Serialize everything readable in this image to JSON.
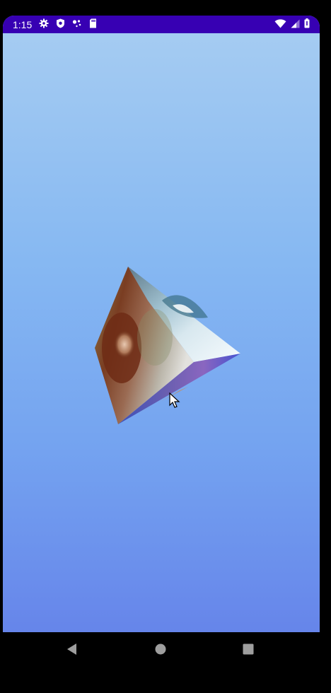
{
  "status_bar": {
    "time": "1:15",
    "background": "#3700b3",
    "left_icons": [
      "settings-icon",
      "shield-icon",
      "assistant-dots-icon",
      "sd-card-icon"
    ],
    "right_icons": [
      "wifi-icon",
      "cell-signal-icon",
      "battery-icon"
    ]
  },
  "screen": {
    "gradient_top": "#a7cdf2",
    "gradient_bottom": "#6685ea",
    "content": "rotating-image-cube"
  },
  "cube": {
    "faces": [
      "portrait-photo",
      "sky-seascape-photo",
      "landscape-photo"
    ]
  },
  "navigation_bar": {
    "buttons": [
      "back-icon",
      "home-icon",
      "recents-icon"
    ]
  }
}
